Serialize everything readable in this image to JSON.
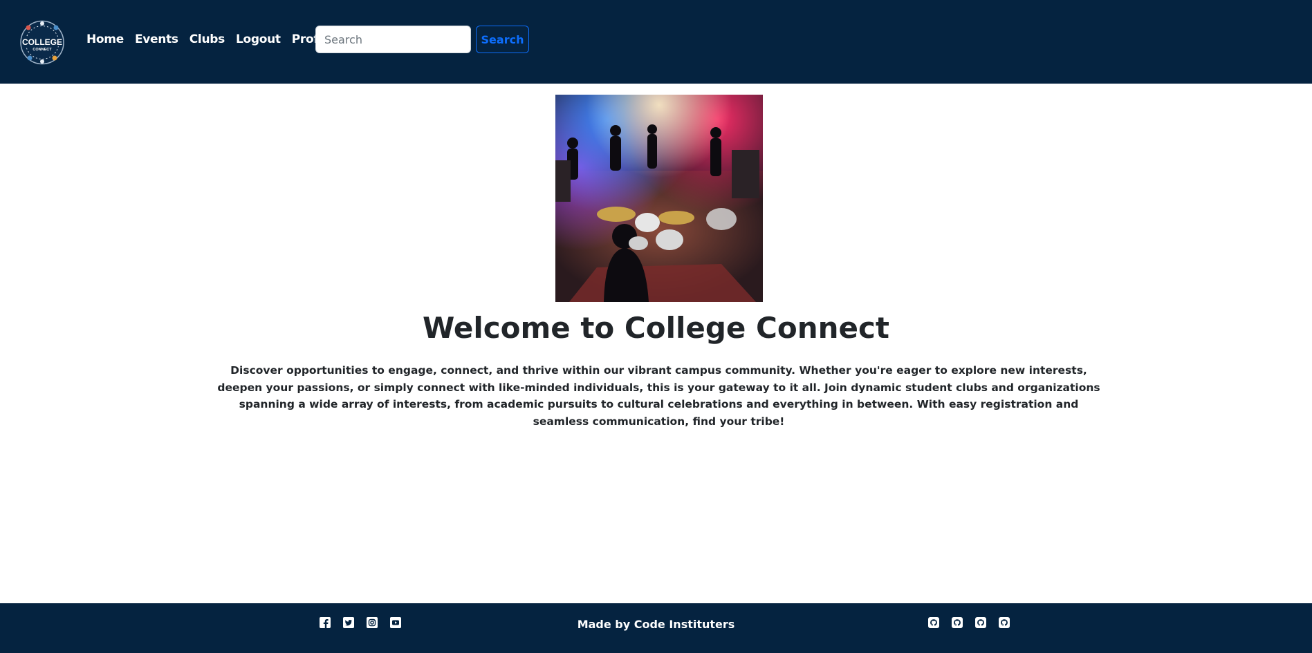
{
  "brand": {
    "logo_title": "COLLEGE",
    "logo_subtitle": "CONNECT"
  },
  "nav": {
    "items": [
      {
        "label": "Home"
      },
      {
        "label": "Events"
      },
      {
        "label": "Clubs"
      },
      {
        "label": "Logout"
      },
      {
        "label": "Profile"
      }
    ]
  },
  "search": {
    "placeholder": "Search",
    "value": "",
    "button_label": "Search"
  },
  "main": {
    "title": "Welcome to College Connect",
    "intro": "Discover opportunities to engage, connect, and thrive within our vibrant campus community. Whether you're eager to explore new interests, deepen your passions, or simply connect with like-minded individuals, this is your gateway to it all. Join dynamic student clubs and organizations spanning a wide array of interests, from academic pursuits to cultural celebrations and everything in between. With easy registration and seamless communication, find your tribe!"
  },
  "footer": {
    "credit": "Made by Code Instituters",
    "social_icons": [
      "facebook-icon",
      "twitter-icon",
      "instagram-icon",
      "youtube-icon"
    ],
    "github_icons": [
      "github-icon",
      "github-icon",
      "github-icon",
      "github-icon"
    ]
  },
  "colors": {
    "navbar_bg": "#052340",
    "accent": "#0d6efd",
    "text": "#212529"
  }
}
